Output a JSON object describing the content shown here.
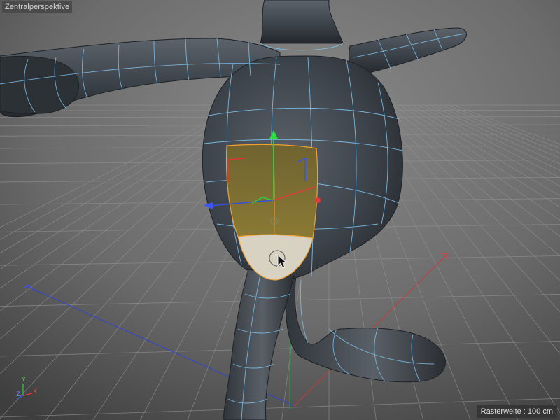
{
  "viewport": {
    "view_label": "Zentralperspektive",
    "grid_label": "Rasterweite",
    "grid_separator": " : ",
    "grid_value": "100 cm",
    "axis_labels": {
      "x": "X",
      "y": "Y",
      "z": "Z"
    }
  },
  "colors": {
    "background": "#4a4a4a",
    "model_body": "#3a4047",
    "wireframe": "#7ec3ee",
    "selection_fill": "#7a6a2a",
    "selection_edge": "#f0a030",
    "selection_highlight": "#d8d2c2",
    "axis_x": "#e03a3a",
    "axis_y": "#30d040",
    "axis_z": "#3050e0"
  },
  "icons": {
    "cursor": "mouse-pointer-icon",
    "gizmo": "move-gizmo-icon",
    "pivot": "pivot-point-icon"
  }
}
